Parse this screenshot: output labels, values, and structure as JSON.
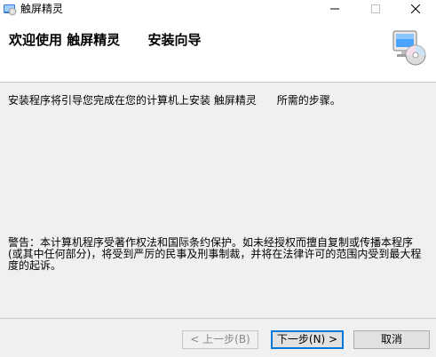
{
  "window": {
    "title": "触屏精灵",
    "minimize_glyph": "–",
    "close_glyph": "✕"
  },
  "banner": {
    "title": "欢迎使用 触屏精灵      安装向导",
    "icon": "cd-install-icon"
  },
  "body": {
    "intro": "安装程序将引导您完成在您的计算机上安装 触屏精灵      所需的步骤。",
    "warning": "警告：本计算机程序受著作权法和国际条约保护。如未经授权而擅自复制或传播本程序(或其中任何部分)，将受到严厉的民事及刑事制裁，并将在法律许可的范围内受到最大程度的起诉。"
  },
  "buttons": {
    "back": "< 上一步(B)",
    "next": "下一步(N) >",
    "cancel": "取消"
  },
  "colors": {
    "accent": "#0078d7",
    "background": "#f0f0f0",
    "banner": "#ffffff"
  }
}
